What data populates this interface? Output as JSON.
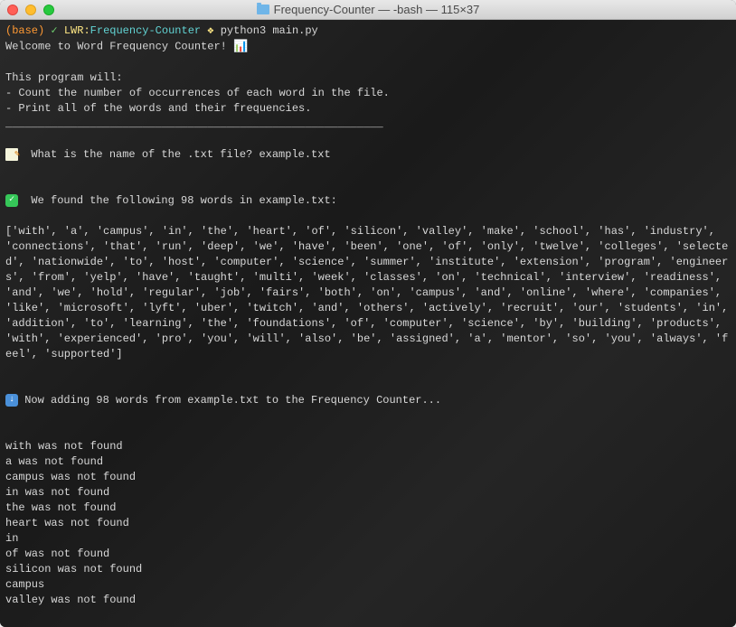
{
  "window": {
    "title": "Frequency-Counter — -bash — 115×37"
  },
  "prompt": {
    "base": "(base)",
    "check": "✓",
    "host": "LWR:",
    "path": "Frequency-Counter",
    "symbol": "❖",
    "command": "python3 main.py"
  },
  "output": {
    "welcome": "Welcome to Word Frequency Counter! ",
    "chart_emoji": "📊",
    "intro_header": "This program will:",
    "intro_line1": "- Count the number of occurrences of each word in the file.",
    "intro_line2": "- Print all of the words and their frequencies.",
    "divider": "__________________________________________________________",
    "prompt_question": "What is the name of the .txt file? example.txt",
    "found_header": "We found the following 98 words in example.txt:",
    "word_list": "['with', 'a', 'campus', 'in', 'the', 'heart', 'of', 'silicon', 'valley', 'make', 'school', 'has', 'industry', 'connections', 'that', 'run', 'deep', 'we', 'have', 'been', 'one', 'of', 'only', 'twelve', 'colleges', 'selected', 'nationwide', 'to', 'host', 'computer', 'science', 'summer', 'institute', 'extension', 'program', 'engineers', 'from', 'yelp', 'have', 'taught', 'multi', 'week', 'classes', 'on', 'technical', 'interview', 'readiness', 'and', 'we', 'hold', 'regular', 'job', 'fairs', 'both', 'on', 'campus', 'and', 'online', 'where', 'companies', 'like', 'microsoft', 'lyft', 'uber', 'twitch', 'and', 'others', 'actively', 'recruit', 'our', 'students', 'in', 'addition', 'to', 'learning', 'the', 'foundations', 'of', 'computer', 'science', 'by', 'building', 'products', 'with', 'experienced', 'pro', 'you', 'will', 'also', 'be', 'assigned', 'a', 'mentor', 'so', 'you', 'always', 'feel', 'supported']",
    "adding_header": "Now adding 98 words from example.txt to the Frequency Counter...",
    "not_found_lines": [
      "with was not found",
      "a was not found",
      "campus was not found",
      "in was not found",
      "the was not found",
      "heart was not found",
      "in",
      "of was not found",
      "silicon was not found",
      "campus",
      "valley was not found"
    ]
  }
}
